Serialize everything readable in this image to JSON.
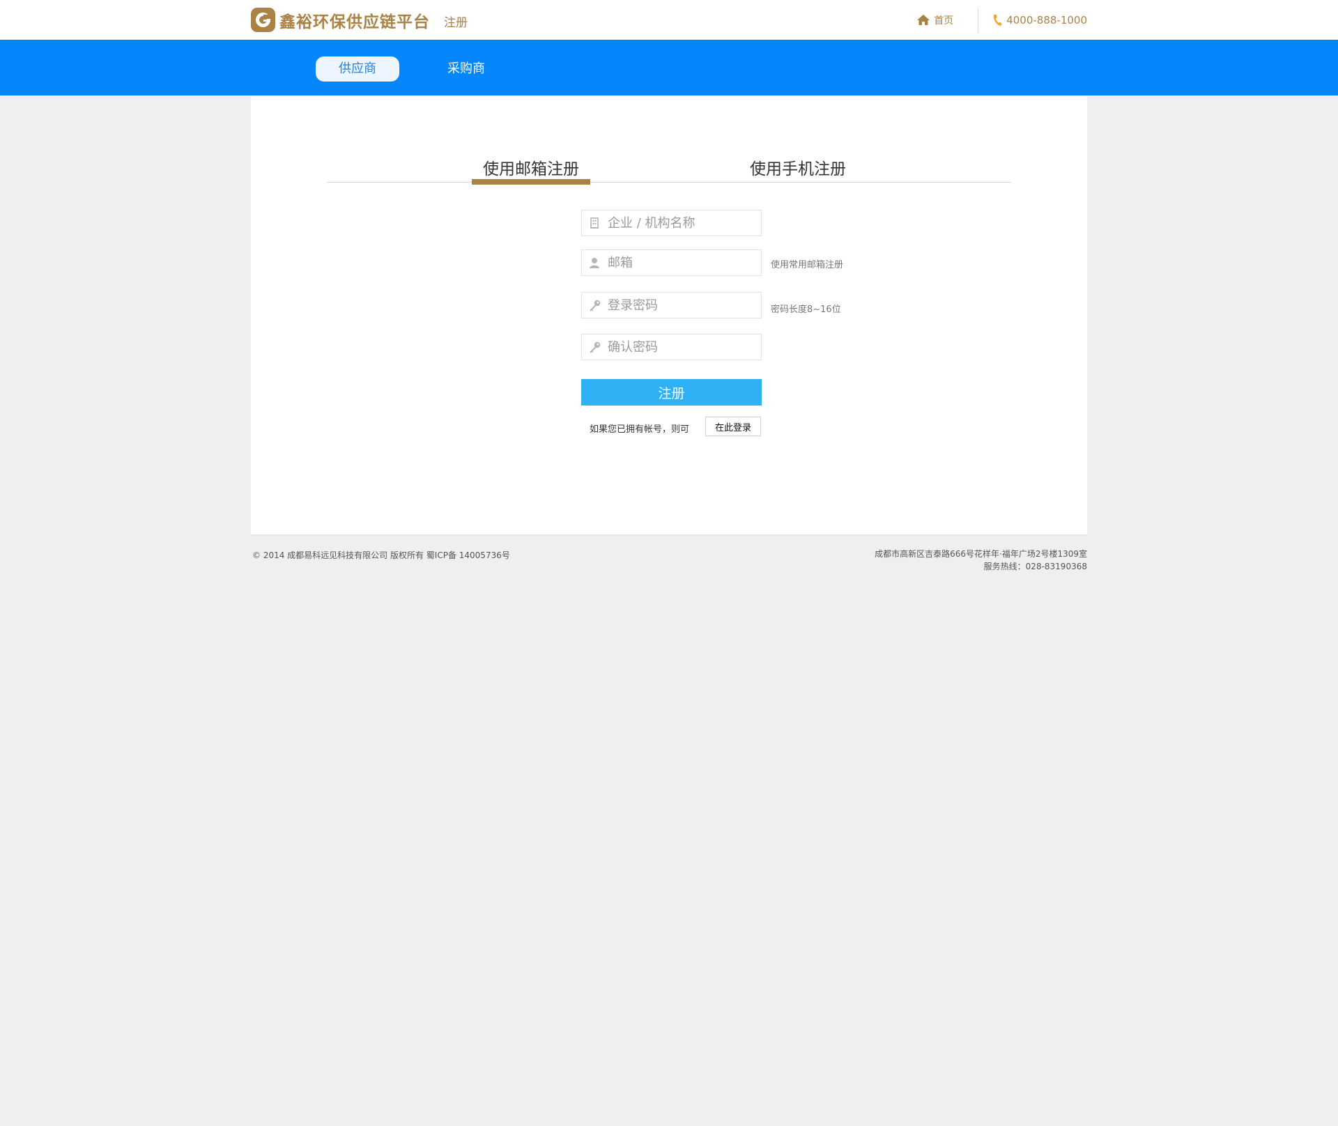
{
  "header": {
    "brand": "鑫裕环保供应链平台",
    "page_label": "注册",
    "home_link": "首页",
    "phone": "4000-888-1000"
  },
  "nav": {
    "tabs": [
      {
        "label": "供应商"
      },
      {
        "label": "采购商"
      }
    ]
  },
  "register": {
    "tabs": [
      {
        "label": "使用邮箱注册"
      },
      {
        "label": "使用手机注册"
      }
    ],
    "fields": {
      "company": {
        "placeholder": "企业 / 机构名称",
        "value": ""
      },
      "email": {
        "placeholder": "邮箱",
        "value": "",
        "hint": "使用常用邮箱注册"
      },
      "password": {
        "placeholder": "登录密码",
        "value": "",
        "hint": "密码长度8~16位"
      },
      "confirm": {
        "placeholder": "确认密码",
        "value": ""
      }
    },
    "submit_label": "注册",
    "login_prompt": "如果您已拥有帐号，则可",
    "login_button": "在此登录"
  },
  "footer": {
    "copyright": "© 2014 成都易科远见科技有限公司 版权所有 蜀ICP备 14005736号",
    "address": "成都市高新区吉泰路666号花样年·福年广场2号楼1309室",
    "hotline": "服务热线：028-83190368"
  },
  "colors": {
    "brand_gold": "#a98346",
    "nav_blue": "#0586fb",
    "button_blue": "#2fb1f5",
    "page_bg": "#f0eff0"
  },
  "icons": [
    "home-icon",
    "phone-icon",
    "building-icon",
    "user-icon",
    "key-icon"
  ]
}
